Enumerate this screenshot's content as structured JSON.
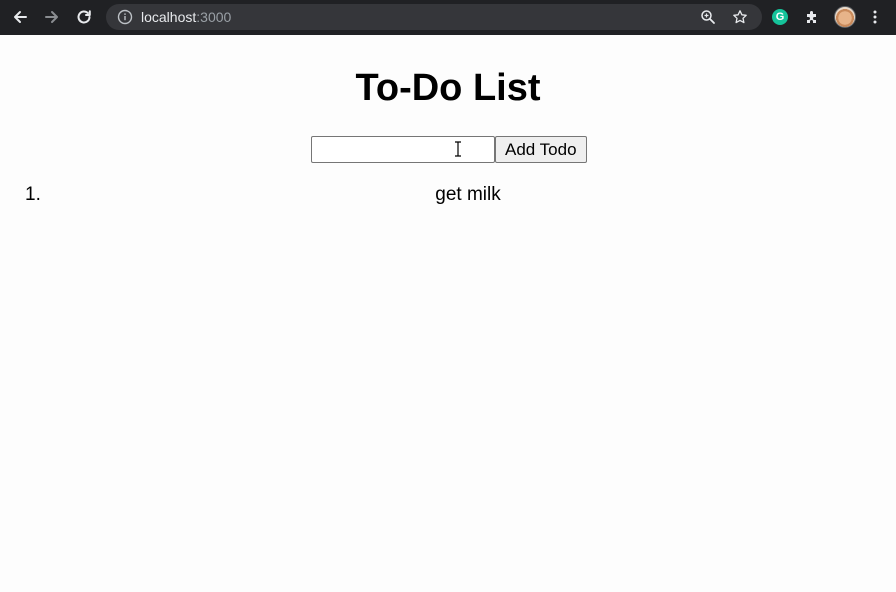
{
  "browser": {
    "url_host": "localhost",
    "url_port": ":3000",
    "icons": [
      "back-arrow-icon",
      "forward-arrow-icon",
      "reload-icon",
      "info-icon",
      "zoom-icon",
      "star-icon",
      "grammarly-icon",
      "puzzle-icon",
      "avatar",
      "kebab-menu-icon"
    ],
    "grammarly_letter": "G"
  },
  "page": {
    "title": "To-Do List",
    "input": {
      "value": "",
      "placeholder": ""
    },
    "add_button_label": "Add Todo",
    "todos": [
      {
        "number": "1.",
        "text": "get milk"
      }
    ]
  }
}
